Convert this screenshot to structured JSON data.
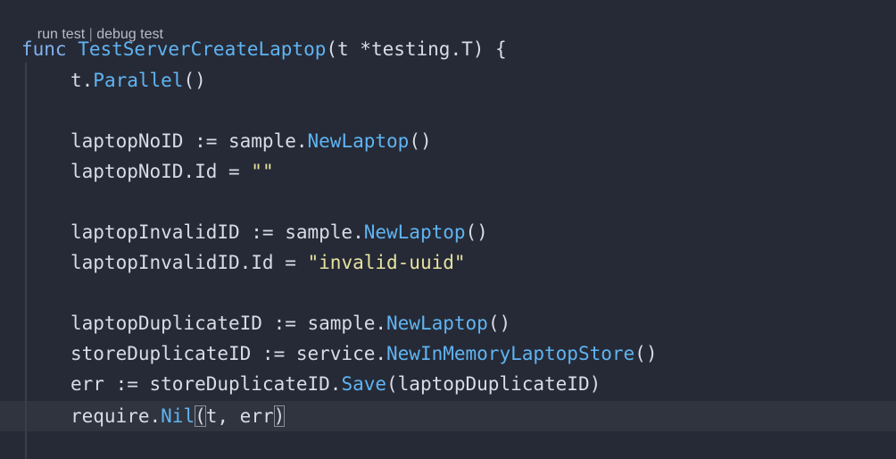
{
  "codelens": {
    "run_test": "run test",
    "separator": " | ",
    "debug_test": "debug test"
  },
  "lines": [
    {
      "tokens": [
        {
          "text": "func ",
          "kind": "keyword"
        },
        {
          "text": "TestServerCreateLaptop",
          "kind": "function"
        },
        {
          "text": "(t *testing.T) {",
          "kind": "plain"
        }
      ]
    },
    {
      "tokens": [
        {
          "text": "t.",
          "kind": "plain"
        },
        {
          "text": "Parallel",
          "kind": "function"
        },
        {
          "text": "()",
          "kind": "plain"
        }
      ]
    },
    {
      "tokens": [
        {
          "text": "laptopNoID := sample.",
          "kind": "plain"
        },
        {
          "text": "NewLaptop",
          "kind": "function"
        },
        {
          "text": "()",
          "kind": "plain"
        }
      ]
    },
    {
      "tokens": [
        {
          "text": "laptopNoID.Id = ",
          "kind": "plain"
        },
        {
          "text": "\"\"",
          "kind": "string"
        }
      ]
    },
    {
      "tokens": [
        {
          "text": "laptopInvalidID := sample.",
          "kind": "plain"
        },
        {
          "text": "NewLaptop",
          "kind": "function"
        },
        {
          "text": "()",
          "kind": "plain"
        }
      ]
    },
    {
      "tokens": [
        {
          "text": "laptopInvalidID.Id = ",
          "kind": "plain"
        },
        {
          "text": "\"invalid-uuid\"",
          "kind": "string"
        }
      ]
    },
    {
      "tokens": [
        {
          "text": "laptopDuplicateID := sample.",
          "kind": "plain"
        },
        {
          "text": "NewLaptop",
          "kind": "function"
        },
        {
          "text": "()",
          "kind": "plain"
        }
      ]
    },
    {
      "tokens": [
        {
          "text": "storeDuplicateID := service.",
          "kind": "plain"
        },
        {
          "text": "NewInMemoryLaptopStore",
          "kind": "function"
        },
        {
          "text": "()",
          "kind": "plain"
        }
      ]
    },
    {
      "tokens": [
        {
          "text": "err := storeDuplicateID.",
          "kind": "plain"
        },
        {
          "text": "Save",
          "kind": "function"
        },
        {
          "text": "(laptopDuplicateID)",
          "kind": "plain"
        }
      ]
    },
    {
      "tokens": [
        {
          "text": "require.",
          "kind": "plain"
        },
        {
          "text": "Nil",
          "kind": "function"
        },
        {
          "text": "(",
          "kind": "bracket-highlight"
        },
        {
          "text": "t, err",
          "kind": "plain"
        },
        {
          "text": ")",
          "kind": "bracket-highlight"
        }
      ]
    }
  ],
  "colors": {
    "background": "#262a36",
    "current_line": "#30343f",
    "keyword": "#7fb2ee",
    "function": "#5fb4f2",
    "string": "#e6e2a0",
    "plain": "#d8dce6"
  }
}
